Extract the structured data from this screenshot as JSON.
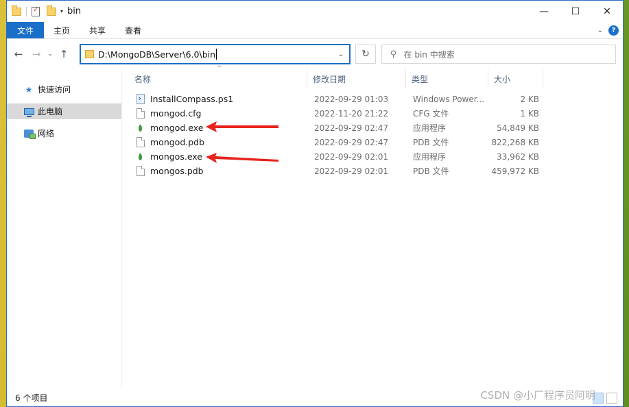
{
  "window": {
    "title": "bin",
    "controls": {
      "minimize": "—",
      "maximize": "☐",
      "close": "✕"
    }
  },
  "ribbon": {
    "file_tab": "文件",
    "tabs": [
      "主页",
      "共享",
      "查看"
    ]
  },
  "address": {
    "path": "D:\\MongoDB\\Server\\6.0\\bin",
    "search_placeholder": "在 bin 中搜索"
  },
  "sidebar": {
    "items": [
      {
        "label": "快速访问",
        "icon": "star-icon",
        "selected": false
      },
      {
        "label": "此电脑",
        "icon": "computer-icon",
        "selected": true
      },
      {
        "label": "网络",
        "icon": "network-icon",
        "selected": false
      }
    ]
  },
  "columns": {
    "name": "名称",
    "date": "修改日期",
    "type": "类型",
    "size": "大小"
  },
  "files": [
    {
      "name": "InstallCompass.ps1",
      "date": "2022-09-29 01:03",
      "type": "Windows Power...",
      "size": "2 KB",
      "icon": "powershell-file-icon"
    },
    {
      "name": "mongod.cfg",
      "date": "2022-11-20 21:22",
      "type": "CFG 文件",
      "size": "1 KB",
      "icon": "document-icon"
    },
    {
      "name": "mongod.exe",
      "date": "2022-09-29 02:47",
      "type": "应用程序",
      "size": "54,849 KB",
      "icon": "mongodb-leaf-icon"
    },
    {
      "name": "mongod.pdb",
      "date": "2022-09-29 02:47",
      "type": "PDB 文件",
      "size": "822,268 KB",
      "icon": "document-icon"
    },
    {
      "name": "mongos.exe",
      "date": "2022-09-29 02:01",
      "type": "应用程序",
      "size": "33,962 KB",
      "icon": "mongodb-leaf-icon"
    },
    {
      "name": "mongos.pdb",
      "date": "2022-09-29 02:01",
      "type": "PDB 文件",
      "size": "459,972 KB",
      "icon": "document-icon"
    }
  ],
  "status": {
    "item_count": "6 个项目"
  },
  "watermark": "CSDN @小厂程序员阿明",
  "colors": {
    "accent": "#1a6fc8",
    "arrow": "#e8231d",
    "selection": "#d9d9d9"
  }
}
